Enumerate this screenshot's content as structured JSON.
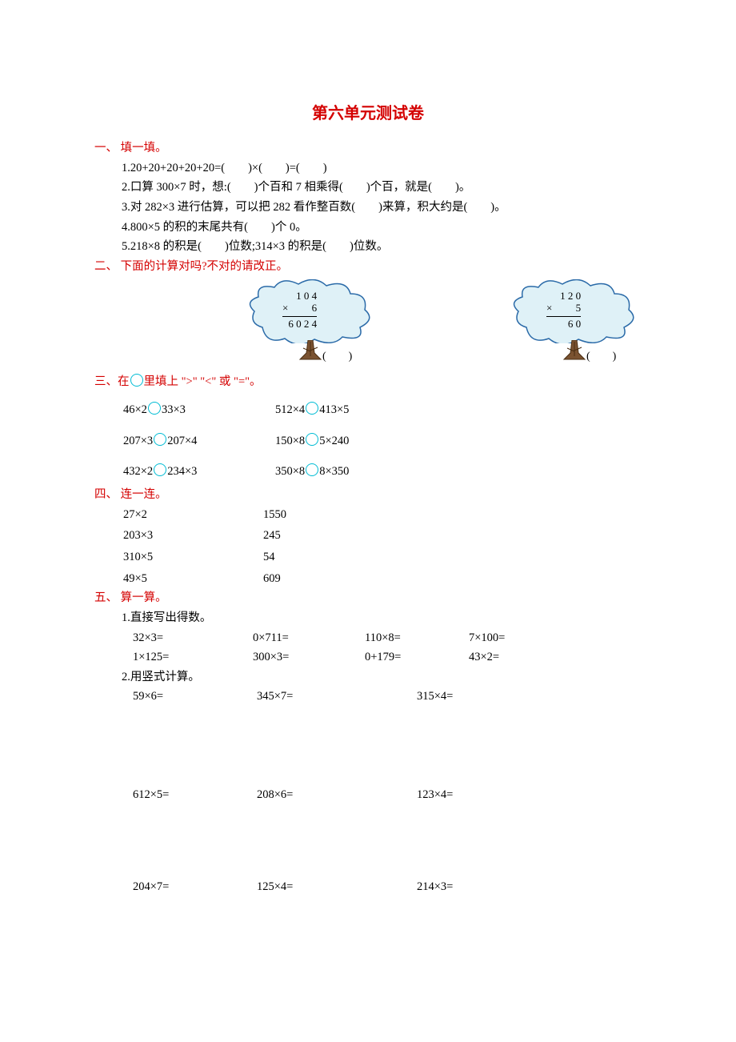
{
  "title": "第六单元测试卷",
  "sections": {
    "s1": {
      "head": "一、 填一填。",
      "items": [
        "1.20+20+20+20+20=(　　)×(　　)=(　　)",
        "2.口算 300×7 时，想:(　　)个百和 7 相乘得(　　)个百，就是(　　)。",
        "3.对 282×3 进行估算，可以把 282 看作整百数(　　)来算，积大约是(　　)。",
        "4.800×5 的积的末尾共有(　　)个 0。",
        "5.218×8 的积是(　　)位数;314×3 的积是(　　)位数。"
      ]
    },
    "s2": {
      "head": "二、 下面的计算对吗?不对的请改正。",
      "tree1": {
        "row1": "　1 0 4",
        "row2": "×　　 6",
        "row3": "6 0 2 4",
        "paren": "(　　)"
      },
      "tree2": {
        "row1": "　1 2 0",
        "row2": "×　　 5",
        "row3": "　　6 0",
        "paren": "(　　)"
      }
    },
    "s3": {
      "head_a": "三、在",
      "head_b": "里填上 \">\" \"<\" 或 \"=\"。",
      "rows": [
        [
          "46×2",
          "33×3",
          "512×4",
          "413×5"
        ],
        [
          "207×3",
          "207×4",
          "150×8",
          "5×240"
        ],
        [
          "432×2",
          "234×3",
          "350×8",
          "8×350"
        ]
      ]
    },
    "s4": {
      "head": "四、 连一连。",
      "left": [
        "27×2",
        "203×3",
        "310×5",
        "49×5"
      ],
      "right": [
        "1550",
        "245",
        "54",
        "609"
      ]
    },
    "s5": {
      "head": "五、 算一算。",
      "sub1": "1.直接写出得数。",
      "grid1": [
        [
          "32×3=",
          "0×711=",
          "110×8=",
          "7×100="
        ],
        [
          "1×125=",
          "300×3=",
          "0+179=",
          "43×2="
        ]
      ],
      "sub2": "2.用竖式计算。",
      "grid2": [
        [
          "59×6=",
          "345×7=",
          "315×4="
        ],
        [
          "612×5=",
          "208×6=",
          "123×4="
        ],
        [
          "204×7=",
          "125×4=",
          "214×3="
        ]
      ]
    }
  }
}
